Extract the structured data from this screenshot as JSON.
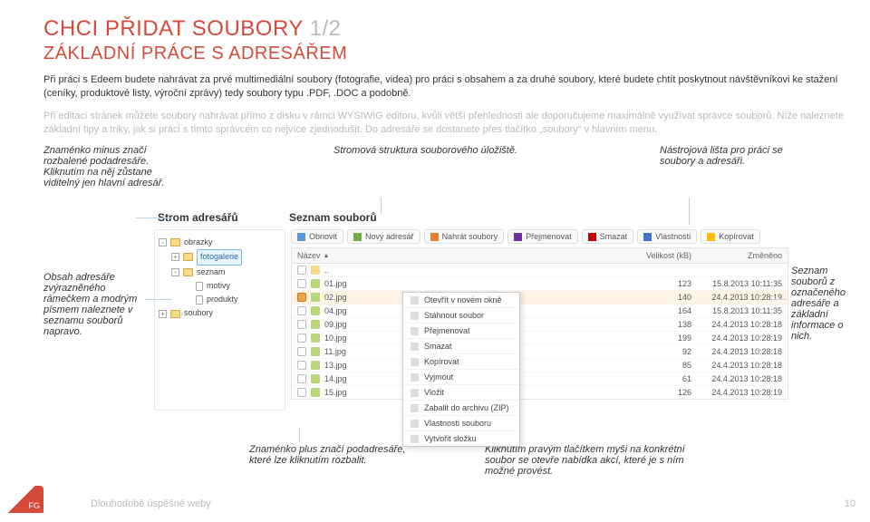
{
  "title_main": "CHCI PŘIDAT SOUBORY ",
  "title_faded": "1/2",
  "subtitle": "ZÁKLADNÍ PRÁCE S ADRESÁŘEM",
  "para1": "Při práci s Edeem budete nahrávat za prvé multimediální soubory (fotografie, videa) pro práci s obsahem a za druhé soubory, které budete chtít poskytnout návštěvníkovi ke stažení (ceníky, produktové listy, výroční zprávy) tedy soubory typu .PDF, .DOC  a podobně.",
  "para2": "Při editaci stránek můžete soubory nahrávat přímo z disku v rámci WYSIWIG editoru, kvůli větší přehlednosti ale doporučujeme maximálně využívat správce souborů. Níže naleznete základní tipy a triky, jak si práci s tímto správcem co nejvíce zjednodušit. Do adresáře se dostanete přes tlačítko „soubory“ v hlavním menu.",
  "annot": {
    "left_top": "Znaménko minus značí rozbalené podadresáře. Kliknutím na něj zůstane viditelný jen hlavní adresář.",
    "mid_top": "Stromová struktura souborového úložiště.",
    "right_top": "Nástrojová lišta pro práci se soubory a adresáři.",
    "left_side": "Obsah adresáře zvýrazněného rámečkem a modrým písmem naleznete v seznamu souborů napravo.",
    "far_right": "Seznam souborů z označeného adresáře a základní informace o nich.",
    "bot1": "Znaménko plus značí podadresáře, které lze kliknutím rozbalit.",
    "bot2": "Kliknutím pravým tlačítkem myši na konkrétní soubor se otevře nabídka akcí, které je s ním možné provést."
  },
  "fm": {
    "header_tree": "Strom adresářů",
    "header_list": "Seznam souborů",
    "tree": [
      {
        "lvl": "l1",
        "tog": "-",
        "type": "fold",
        "label": "obrazky"
      },
      {
        "lvl": "l2",
        "tog": "+",
        "type": "fold",
        "label": "fotogalerie",
        "sel": true
      },
      {
        "lvl": "l2",
        "tog": "-",
        "type": "fold",
        "label": "seznam"
      },
      {
        "lvl": "l3",
        "tog": "",
        "type": "file",
        "label": "motivy"
      },
      {
        "lvl": "l3",
        "tog": "",
        "type": "file",
        "label": "produkty"
      },
      {
        "lvl": "l1",
        "tog": "+",
        "type": "fold",
        "label": "soubory"
      }
    ],
    "toolbar": [
      "Obnovit",
      "Nový adresář",
      "Nahrát soubory",
      "Přejmenovat",
      "Smazat",
      "Vlastnosti",
      "Kopírovat"
    ],
    "cols": {
      "c1": "Název",
      "c2": "Velikost (kB)",
      "c3": "Změněno"
    },
    "rows": [
      {
        "up": true,
        "name": "..",
        "size": "",
        "date": ""
      },
      {
        "name": "01.jpg",
        "size": "123",
        "date": "15.8.2013 10:11:35"
      },
      {
        "name": "02.jpg",
        "size": "140",
        "date": "24.4.2013 10:28:19",
        "sel": true
      },
      {
        "name": "04.jpg",
        "size": "164",
        "date": "15.8.2013 10:11:35"
      },
      {
        "name": "09.jpg",
        "size": "138",
        "date": "24.4.2013 10:28:18"
      },
      {
        "name": "10.jpg",
        "size": "199",
        "date": "24.4.2013 10:28:19"
      },
      {
        "name": "11.jpg",
        "size": "92",
        "date": "24.4.2013 10:28:18"
      },
      {
        "name": "13.jpg",
        "size": "85",
        "date": "24.4.2013 10:28:18"
      },
      {
        "name": "14.jpg",
        "size": "61",
        "date": "24.4.2013 10:28:18"
      },
      {
        "name": "15.jpg",
        "size": "126",
        "date": "24.4.2013 10:28:19"
      }
    ],
    "ctx": [
      "Otevřít v novém okně",
      "Stáhnout soubor",
      "Přejmenovat",
      "Smazat",
      "Kopírovat",
      "Vyjmout",
      "Vložit",
      "Zabalit do archivu (ZIP)",
      "Vlastnosti souboru",
      "Vytvořit složku"
    ]
  },
  "footer": {
    "logo": "FG",
    "text": "Dlouhodobě úspěšné weby",
    "page": "10"
  }
}
